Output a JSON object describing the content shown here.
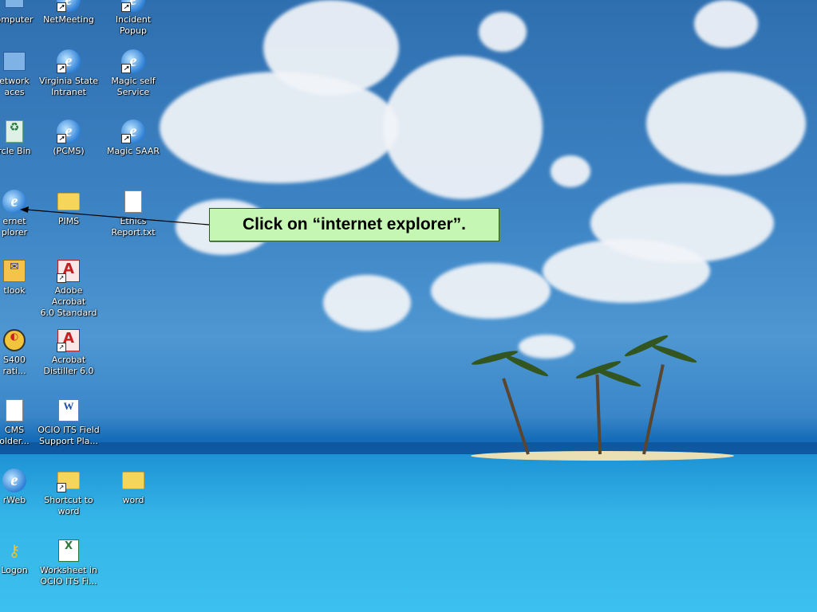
{
  "callout": {
    "text": "Click on “internet explorer”."
  },
  "icons": [
    {
      "label": "omputer",
      "icon": "my-computer-icon"
    },
    {
      "label": "NetMeeting",
      "icon": "netmeeting-icon"
    },
    {
      "label": "Incident Popup",
      "icon": "ie-shortcut-icon"
    },
    {
      "label": "etwork\naces",
      "icon": "network-places-icon"
    },
    {
      "label": "Virginia State\nIntranet",
      "icon": "ie-shortcut-icon"
    },
    {
      "label": "Magic self\nService",
      "icon": "ie-shortcut-icon"
    },
    {
      "label": "rcle Bin",
      "icon": "recycle-bin-icon"
    },
    {
      "label": "(PCMS)",
      "icon": "ie-shortcut-icon"
    },
    {
      "label": "Magic SAAR",
      "icon": "ie-shortcut-icon"
    },
    {
      "label": "ernet\nplorer",
      "icon": "internet-explorer-icon"
    },
    {
      "label": "PIMS",
      "icon": "folder-icon"
    },
    {
      "label": "Ethics\nReport.txt",
      "icon": "text-document-icon"
    },
    {
      "label": "tlook",
      "icon": "outlook-icon"
    },
    {
      "label": "Adobe Acrobat\n6.0 Standard",
      "icon": "acrobat-icon"
    },
    {
      "label": "S400\nrati...",
      "icon": "as400-icon"
    },
    {
      "label": "Acrobat\nDistiller 6.0",
      "icon": "acrobat-distiller-icon"
    },
    {
      "label": "CMS\nolder...",
      "icon": "document-icon"
    },
    {
      "label": "OCIO ITS Field\nSupport Pla...",
      "icon": "word-document-icon"
    },
    {
      "label": "rWeb",
      "icon": "ie-icon"
    },
    {
      "label": "Shortcut to\nword",
      "icon": "folder-shortcut-icon"
    },
    {
      "label": "word",
      "icon": "folder-icon"
    },
    {
      "label": "Logon",
      "icon": "key-icon"
    },
    {
      "label": "Worksheet in\nOCIO ITS Fi...",
      "icon": "excel-worksheet-icon"
    }
  ]
}
